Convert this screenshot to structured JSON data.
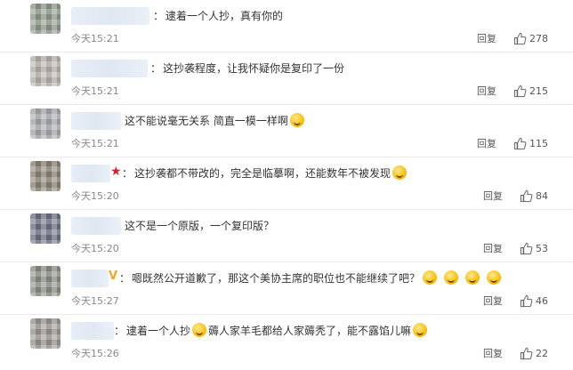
{
  "comments": [
    {
      "text": "逮着一个人抄，真有你的",
      "time": "今天15:21",
      "reply": "回复",
      "likes": "278",
      "emojis": []
    },
    {
      "text": "这抄袭程度，让我怀疑你是复印了一份",
      "time": "今天15:21",
      "reply": "回复",
      "likes": "215",
      "emojis": []
    },
    {
      "text": "这不能说毫无关系 简直一模一样啊",
      "time": "今天15:21",
      "reply": "回复",
      "likes": "115",
      "emojis": [
        "thinking"
      ]
    },
    {
      "text": "这抄袭都不带改的，完全是临摹啊，还能数年不被发现",
      "time": "今天15:20",
      "reply": "回复",
      "likes": "84",
      "emojis": [
        "drool"
      ]
    },
    {
      "text": "这不是一个原版，一个复印版？",
      "time": "今天15:20",
      "reply": "回复",
      "likes": "53",
      "emojis": []
    },
    {
      "text": "嗯既然公开道歉了，那这个美协主席的职位也不能继续了吧？",
      "time": "今天15:27",
      "reply": "回复",
      "likes": "46",
      "emojis": [
        "angry",
        "angry",
        "angry",
        "angry"
      ]
    },
    {
      "text_a": "逮着一个人抄",
      "text_b": "薅人家羊毛都给人家薅秃了，能不露馅儿嘛",
      "time": "今天15:26",
      "reply": "回复",
      "likes": "22",
      "emojis": [
        "laugh-cry",
        "grin"
      ]
    }
  ],
  "colors": {
    "name_blur": "#e3ebf5",
    "verified_red": "#e6162d",
    "verified_gold": "#f5a623"
  }
}
